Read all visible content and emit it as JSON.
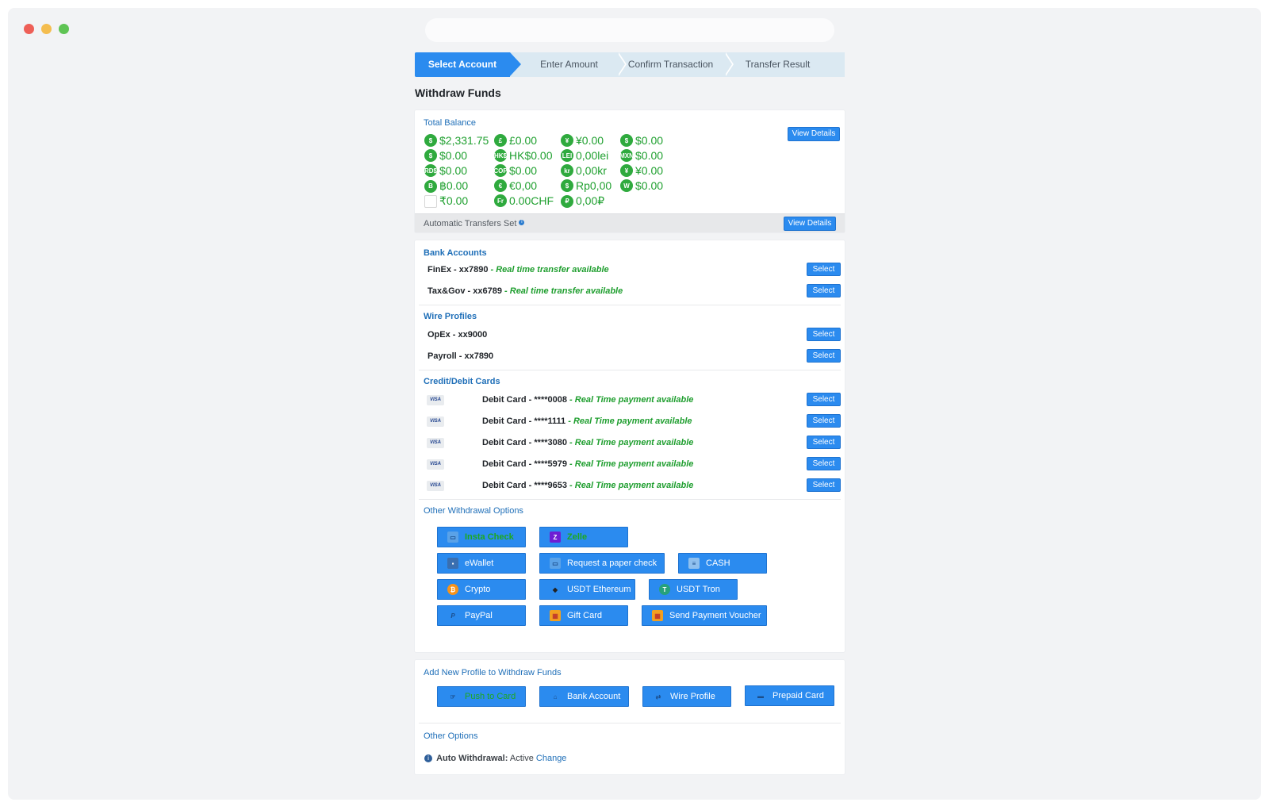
{
  "stepper": {
    "steps": [
      "Select Account",
      "Enter Amount",
      "Confirm Transaction",
      "Transfer Result"
    ],
    "active_index": 0
  },
  "page_title": "Withdraw Funds",
  "balance": {
    "title": "Total Balance",
    "view_details": "View Details",
    "items": [
      {
        "icon": "$",
        "amount": "$2,331.75"
      },
      {
        "icon": "£",
        "amount": "£0.00"
      },
      {
        "icon": "¥",
        "amount": "¥0.00"
      },
      {
        "icon": "$",
        "amount": "$0.00"
      },
      {
        "icon": "$",
        "amount": "$0.00"
      },
      {
        "icon": "HK$",
        "amount": "HK$0.00"
      },
      {
        "icon": "LEI",
        "amount": "0,00lei"
      },
      {
        "icon": "MXN",
        "amount": "$0.00"
      },
      {
        "icon": "RD$",
        "amount": "$0.00"
      },
      {
        "icon": "COP",
        "amount": "$0.00"
      },
      {
        "icon": "kr",
        "amount": "0,00kr"
      },
      {
        "icon": "¥",
        "amount": "¥0.00"
      },
      {
        "icon": "B",
        "amount": "฿0.00"
      },
      {
        "icon": "€",
        "amount": "€0,00"
      },
      {
        "icon": "$",
        "amount": "Rp0,00"
      },
      {
        "icon": "W",
        "amount": "$0.00"
      },
      {
        "icon": "",
        "amount": "₹0.00"
      },
      {
        "icon": "Fr",
        "amount": "0.00CHF"
      },
      {
        "icon": "₽",
        "amount": "0,00₽"
      }
    ],
    "auto_transfers_label": "Automatic Transfers Set",
    "auto_view_details": "View Details"
  },
  "bank_accounts": {
    "title": "Bank Accounts",
    "items": [
      {
        "name": "FinEx - xx7890",
        "note": "Real time transfer available"
      },
      {
        "name": "Tax&Gov - xx6789",
        "note": "Real time transfer available"
      }
    ]
  },
  "wire_profiles": {
    "title": "Wire Profiles",
    "items": [
      {
        "name": "OpEx - xx9000"
      },
      {
        "name": "Payroll - xx7890"
      }
    ]
  },
  "cards": {
    "title": "Credit/Debit Cards",
    "brand": "VISA",
    "items": [
      {
        "name": "Debit Card - ****0008",
        "note": "Real Time payment available"
      },
      {
        "name": "Debit Card - ****1111",
        "note": "Real Time payment available"
      },
      {
        "name": "Debit Card - ****3080",
        "note": "Real Time payment available"
      },
      {
        "name": "Debit Card - ****5979",
        "note": "Real Time payment available"
      },
      {
        "name": "Debit Card - ****9653",
        "note": "Real Time payment available"
      }
    ]
  },
  "select_label": "Select",
  "other_withdrawal": {
    "title": "Other Withdrawal Options",
    "buttons": {
      "insta_check": "Insta Check",
      "zelle": "Zelle",
      "ewallet": "eWallet",
      "paper_check": "Request a paper check",
      "cash": "CASH",
      "crypto": "Crypto",
      "usdt_eth": "USDT Ethereum",
      "usdt_tron": "USDT Tron",
      "paypal": "PayPal",
      "gift_card": "Gift Card",
      "send_voucher": "Send Payment Voucher"
    }
  },
  "add_profile": {
    "title": "Add New Profile to Withdraw Funds",
    "buttons": {
      "push_to_card": "Push to Card",
      "bank_account": "Bank Account",
      "wire_profile": "Wire Profile",
      "prepaid_card": "Prepaid Card"
    }
  },
  "other_options": {
    "title": "Other Options",
    "auto_withdrawal_label": "Auto Withdrawal:",
    "auto_withdrawal_status": "Active",
    "change_link": "Change"
  },
  "colors": {
    "primary": "#2b8bef",
    "balance_green": "#20a030",
    "section_blue": "#1f6fb8"
  }
}
